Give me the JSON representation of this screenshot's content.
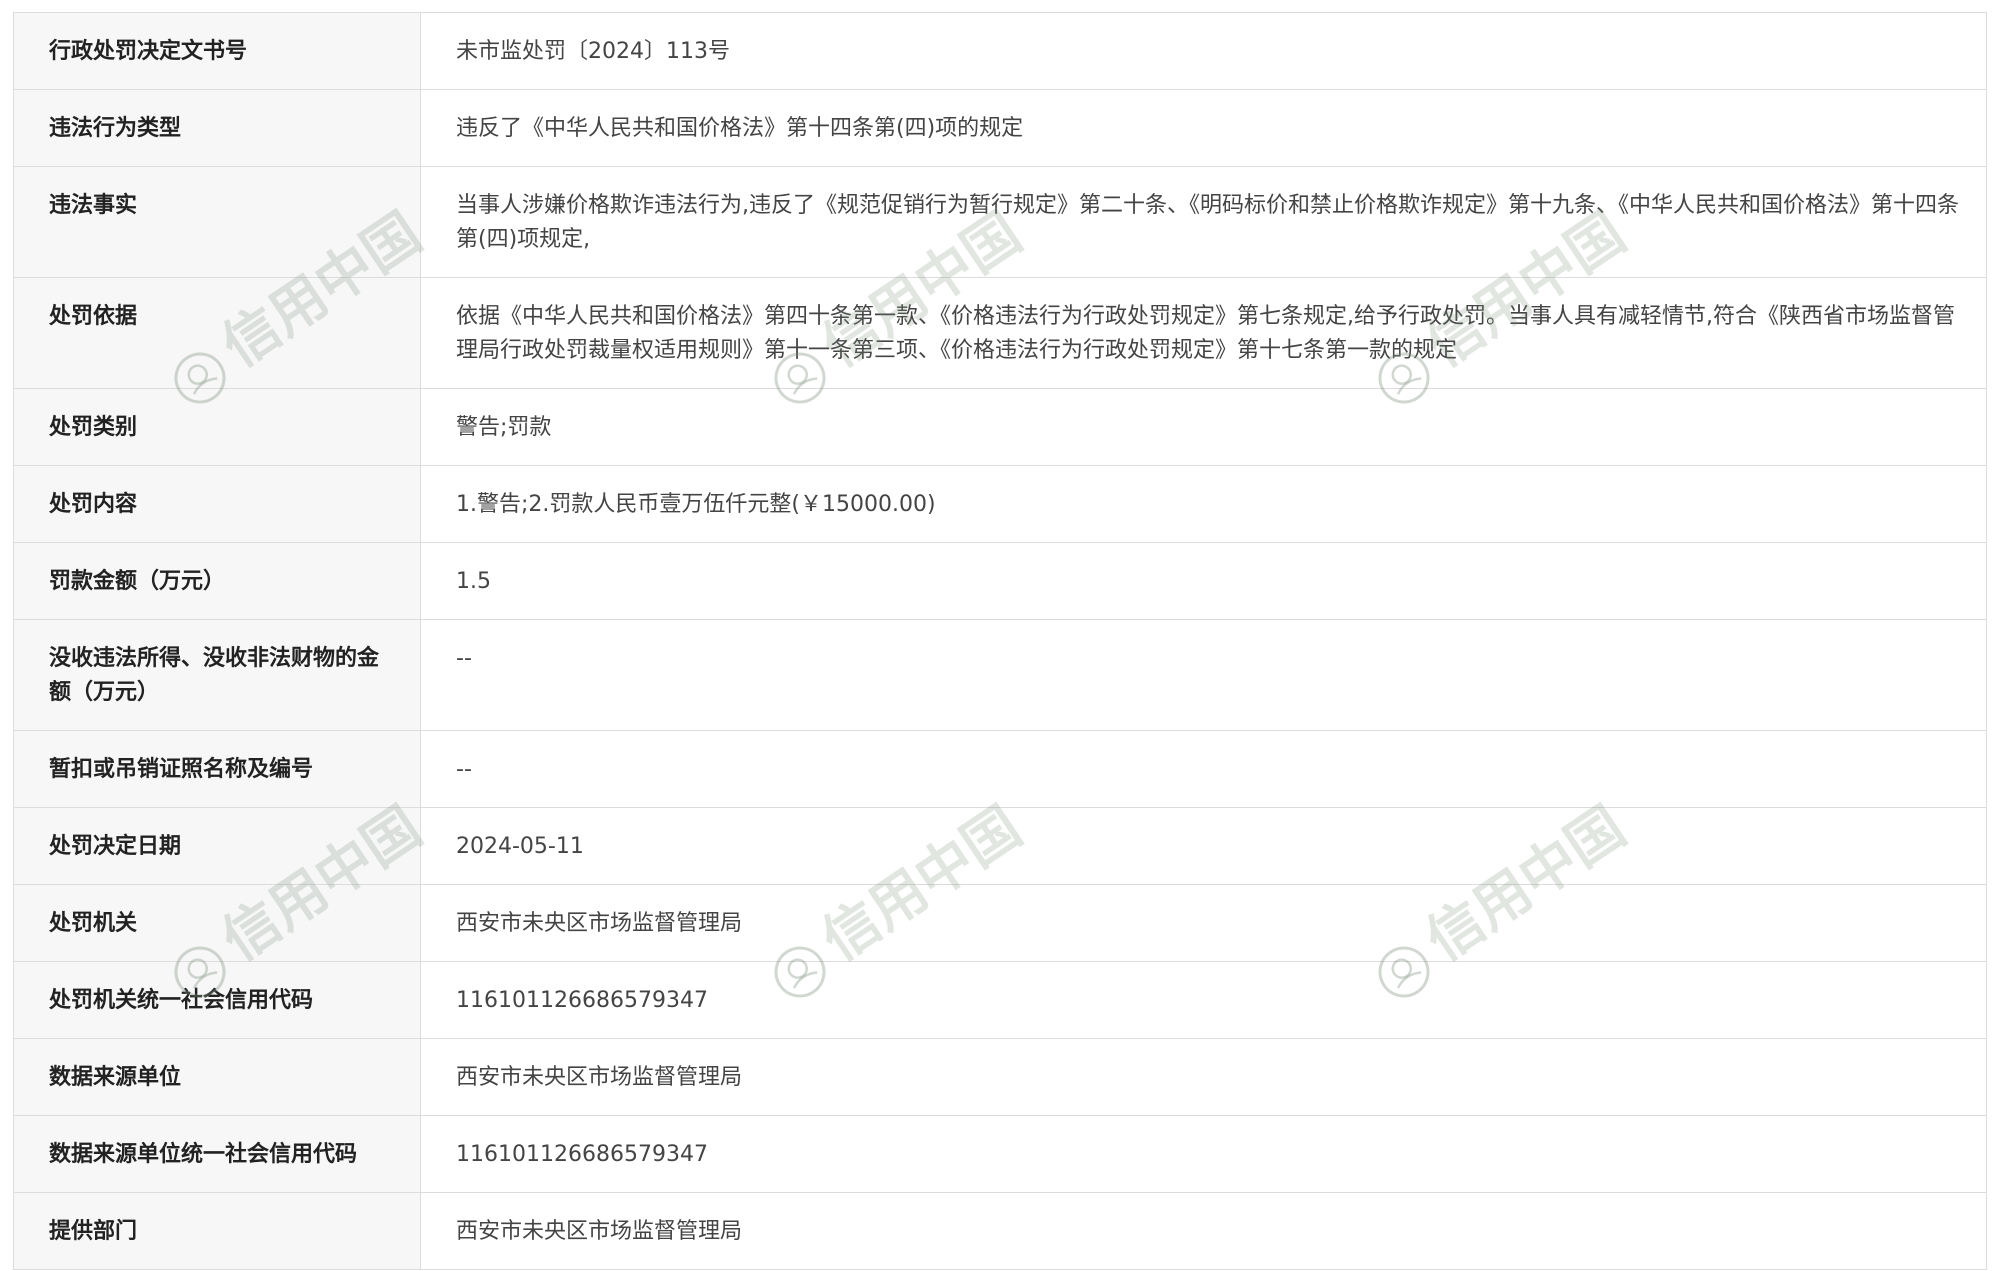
{
  "rows": [
    {
      "label": "行政处罚决定文书号",
      "value": "未市监处罚〔2024〕113号"
    },
    {
      "label": "违法行为类型",
      "value": "违反了《中华人民共和国价格法》第十四条第(四)项的规定"
    },
    {
      "label": "违法事实",
      "value": "当事人涉嫌价格欺诈违法行为,违反了《规范促销行为暂行规定》第二十条、《明码标价和禁止价格欺诈规定》第十九条、《中华人民共和国价格法》第十四条第(四)项规定,"
    },
    {
      "label": "处罚依据",
      "value": "依据《中华人民共和国价格法》第四十条第一款、《价格违法行为行政处罚规定》第七条规定,给予行政处罚。当事人具有减轻情节,符合《陕西省市场监督管理局行政处罚裁量权适用规则》第十一条第三项、《价格违法行为行政处罚规定》第十七条第一款的规定"
    },
    {
      "label": "处罚类别",
      "value": "警告;罚款"
    },
    {
      "label": "处罚内容",
      "value": "1.警告;2.罚款人民币壹万伍仟元整(￥15000.00)"
    },
    {
      "label": "罚款金额（万元）",
      "value": "1.5"
    },
    {
      "label": "没收违法所得、没收非法财物的金额（万元）",
      "value": "--"
    },
    {
      "label": "暂扣或吊销证照名称及编号",
      "value": "--"
    },
    {
      "label": "处罚决定日期",
      "value": "2024-05-11"
    },
    {
      "label": "处罚机关",
      "value": "西安市未央区市场监督管理局"
    },
    {
      "label": "处罚机关统一社会信用代码",
      "value": "116101126686579347"
    },
    {
      "label": "数据来源单位",
      "value": "西安市未央区市场监督管理局"
    },
    {
      "label": "数据来源单位统一社会信用代码",
      "value": "116101126686579347"
    },
    {
      "label": "提供部门",
      "value": "西安市未央区市场监督管理局"
    }
  ],
  "watermark": {
    "text": "信用中国",
    "emblem_icon": "national-emblem-icon",
    "color": "#7a8f7a"
  }
}
